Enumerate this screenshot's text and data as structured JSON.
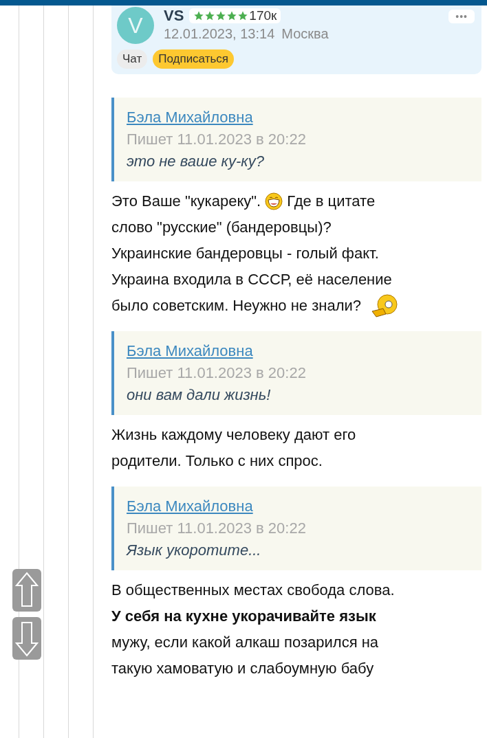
{
  "author_card": {
    "avatar_letter": "V",
    "name": "VS",
    "stars": 5,
    "rating": "170к",
    "date": "12.01.2023, 13:14",
    "city": "Москва",
    "more": "•••",
    "buttons": [
      {
        "label": "Чат",
        "kind": "plain"
      },
      {
        "label": "Подписаться",
        "kind": "accent"
      }
    ]
  },
  "blocks": [
    {
      "kind": "quote",
      "author": "Бэла Михайловна",
      "date": "Пишет 11.01.2023 в 20:22",
      "text": "это не ваше ку-ку?"
    },
    {
      "kind": "paragraph",
      "lines": [
        [
          {
            "kind": "text",
            "text": "Это Ваше \"кукареку\"."
          },
          {
            "kind": "smile"
          },
          {
            "kind": "text",
            "text": "Где в цитате"
          }
        ],
        [
          {
            "kind": "text",
            "text": "слово \"русские\" (бандеровцы)?"
          }
        ],
        [
          {
            "kind": "text",
            "text": "Украинские бандеровцы - голый факт."
          }
        ],
        [
          {
            "kind": "text",
            "text": "Украина входила в СССР, её население"
          }
        ],
        [
          {
            "kind": "text",
            "text": "было советским. Неужно не знали?"
          },
          {
            "kind": "point"
          }
        ]
      ]
    },
    {
      "kind": "quote",
      "author": "Бэла Михайловна",
      "date": "Пишет 11.01.2023 в 20:22",
      "text": "они вам дали жизнь!"
    },
    {
      "kind": "paragraph",
      "lines": [
        [
          {
            "kind": "text",
            "text": "Жизнь каждому человеку дают его"
          }
        ],
        [
          {
            "kind": "text",
            "text": "родители. Только с них спрос."
          }
        ]
      ]
    },
    {
      "kind": "quote",
      "author": "Бэла Михайловна",
      "date": "Пишет 11.01.2023 в 20:22",
      "text": "Язык укоротите..."
    },
    {
      "kind": "paragraph",
      "lines": [
        [
          {
            "kind": "text",
            "text": "В общественных местах свобода слова."
          }
        ],
        [
          {
            "kind": "text",
            "text": "**У себя на кухне укорачивайте язык**"
          }
        ],
        [
          {
            "kind": "text",
            "text": "мужу, если какой алкаш позарился на"
          }
        ],
        [
          {
            "kind": "text",
            "text": "такую хамоватую и слабоумную бабу"
          }
        ]
      ]
    }
  ],
  "scroll_buttons": [
    {
      "kind": "up"
    },
    {
      "kind": "down"
    }
  ]
}
